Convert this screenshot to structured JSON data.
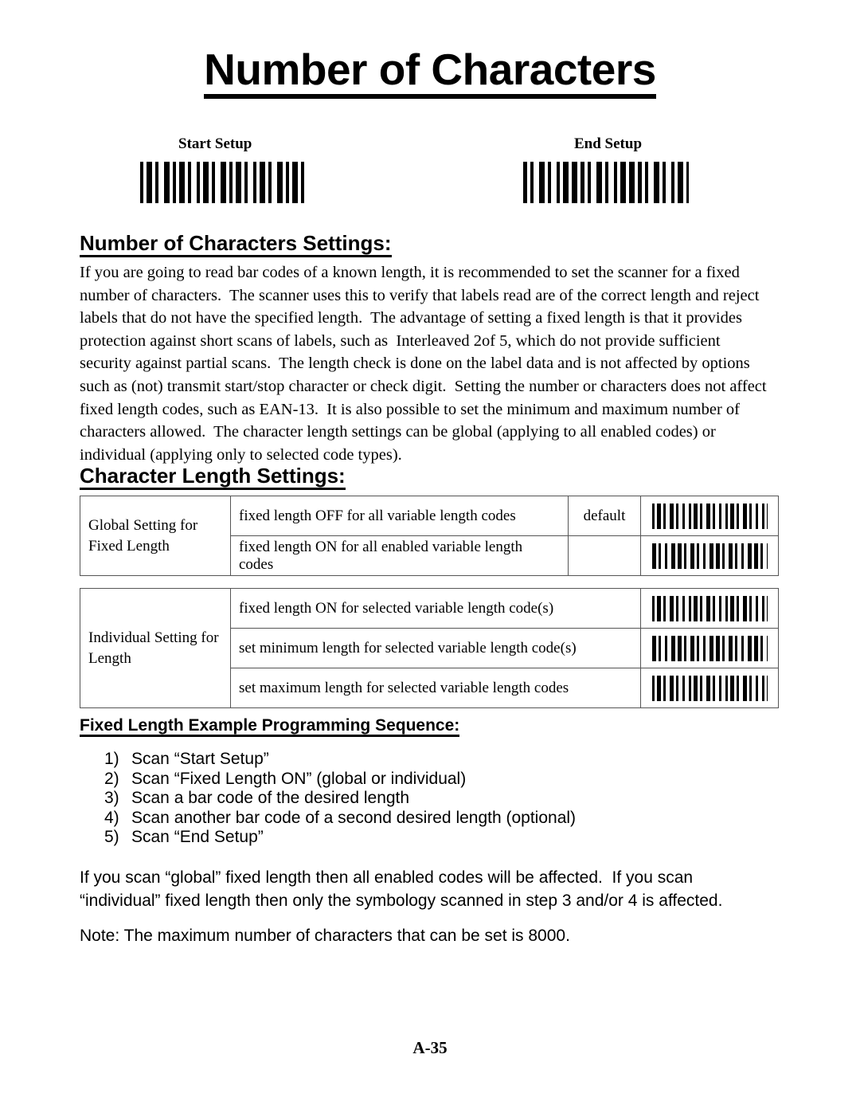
{
  "document": {
    "title": "Number of Characters",
    "page_number": "A-35"
  },
  "setup_codes": {
    "start_label": "Start Setup",
    "end_label": "End Setup",
    "start_barcode_name": "start-setup-barcode",
    "end_barcode_name": "end-setup-barcode"
  },
  "sections": {
    "settings": {
      "heading": "Number of Characters Settings:",
      "body": "If you are going to read bar codes of a known length, it is recommended to set the scanner for a fixed number of characters.  The scanner uses this to verify that labels read are of the correct length and reject labels that do not have the specified length.  The advantage of setting a fixed length is that it provides protection against short scans of labels, such as  Interleaved 2of 5, which do not provide sufficient security against partial scans.  The length check is done on the label data and is not affected by options such as (not) transmit start/stop character or check digit.  Setting the number or characters does not affect fixed length codes, such as EAN-13.  It is also possible to set the minimum and maximum number of characters allowed.  The character length settings can be global (applying to all enabled codes) or individual (applying only to selected code types)."
    },
    "character_length": {
      "heading": "Character Length Settings:"
    },
    "example": {
      "heading": "Fixed Length Example Programming Sequence:"
    }
  },
  "global_table": {
    "label": "Global Setting\nfor Fixed Length",
    "rows": [
      {
        "description": "fixed length OFF for all variable length codes",
        "default": "default",
        "barcode": "global-fixed-length-off-barcode"
      },
      {
        "description": "fixed length ON for all enabled variable length codes",
        "default": "",
        "barcode": "global-fixed-length-on-barcode"
      }
    ]
  },
  "individual_table": {
    "label": "Individual Setting\nfor Length",
    "rows": [
      {
        "description": "fixed length ON for selected variable length code(s)",
        "barcode": "individual-fixed-length-on-barcode"
      },
      {
        "description": "set minimum length for selected variable length code(s)",
        "barcode": "set-minimum-length-barcode"
      },
      {
        "description": "set maximum length for selected variable length codes",
        "barcode": "set-maximum-length-barcode"
      }
    ]
  },
  "steps": [
    {
      "num": "1)",
      "text": "Scan “Start Setup”"
    },
    {
      "num": "2)",
      "text": "Scan “Fixed Length ON” (global or individual)"
    },
    {
      "num": "3)",
      "text": "Scan a bar code of the desired length"
    },
    {
      "num": "4)",
      "text": "Scan another bar code of a second desired length (optional)"
    },
    {
      "num": "5)",
      "text": "Scan “End Setup”"
    }
  ],
  "closing": {
    "paragraph": "If you scan “global” fixed length then all enabled codes will be affected.  If you scan\n“individual” fixed length then only the symbology scanned in step 3 and/or 4 is affected.",
    "note": "Note: The maximum number of characters that can be set is 8000."
  }
}
